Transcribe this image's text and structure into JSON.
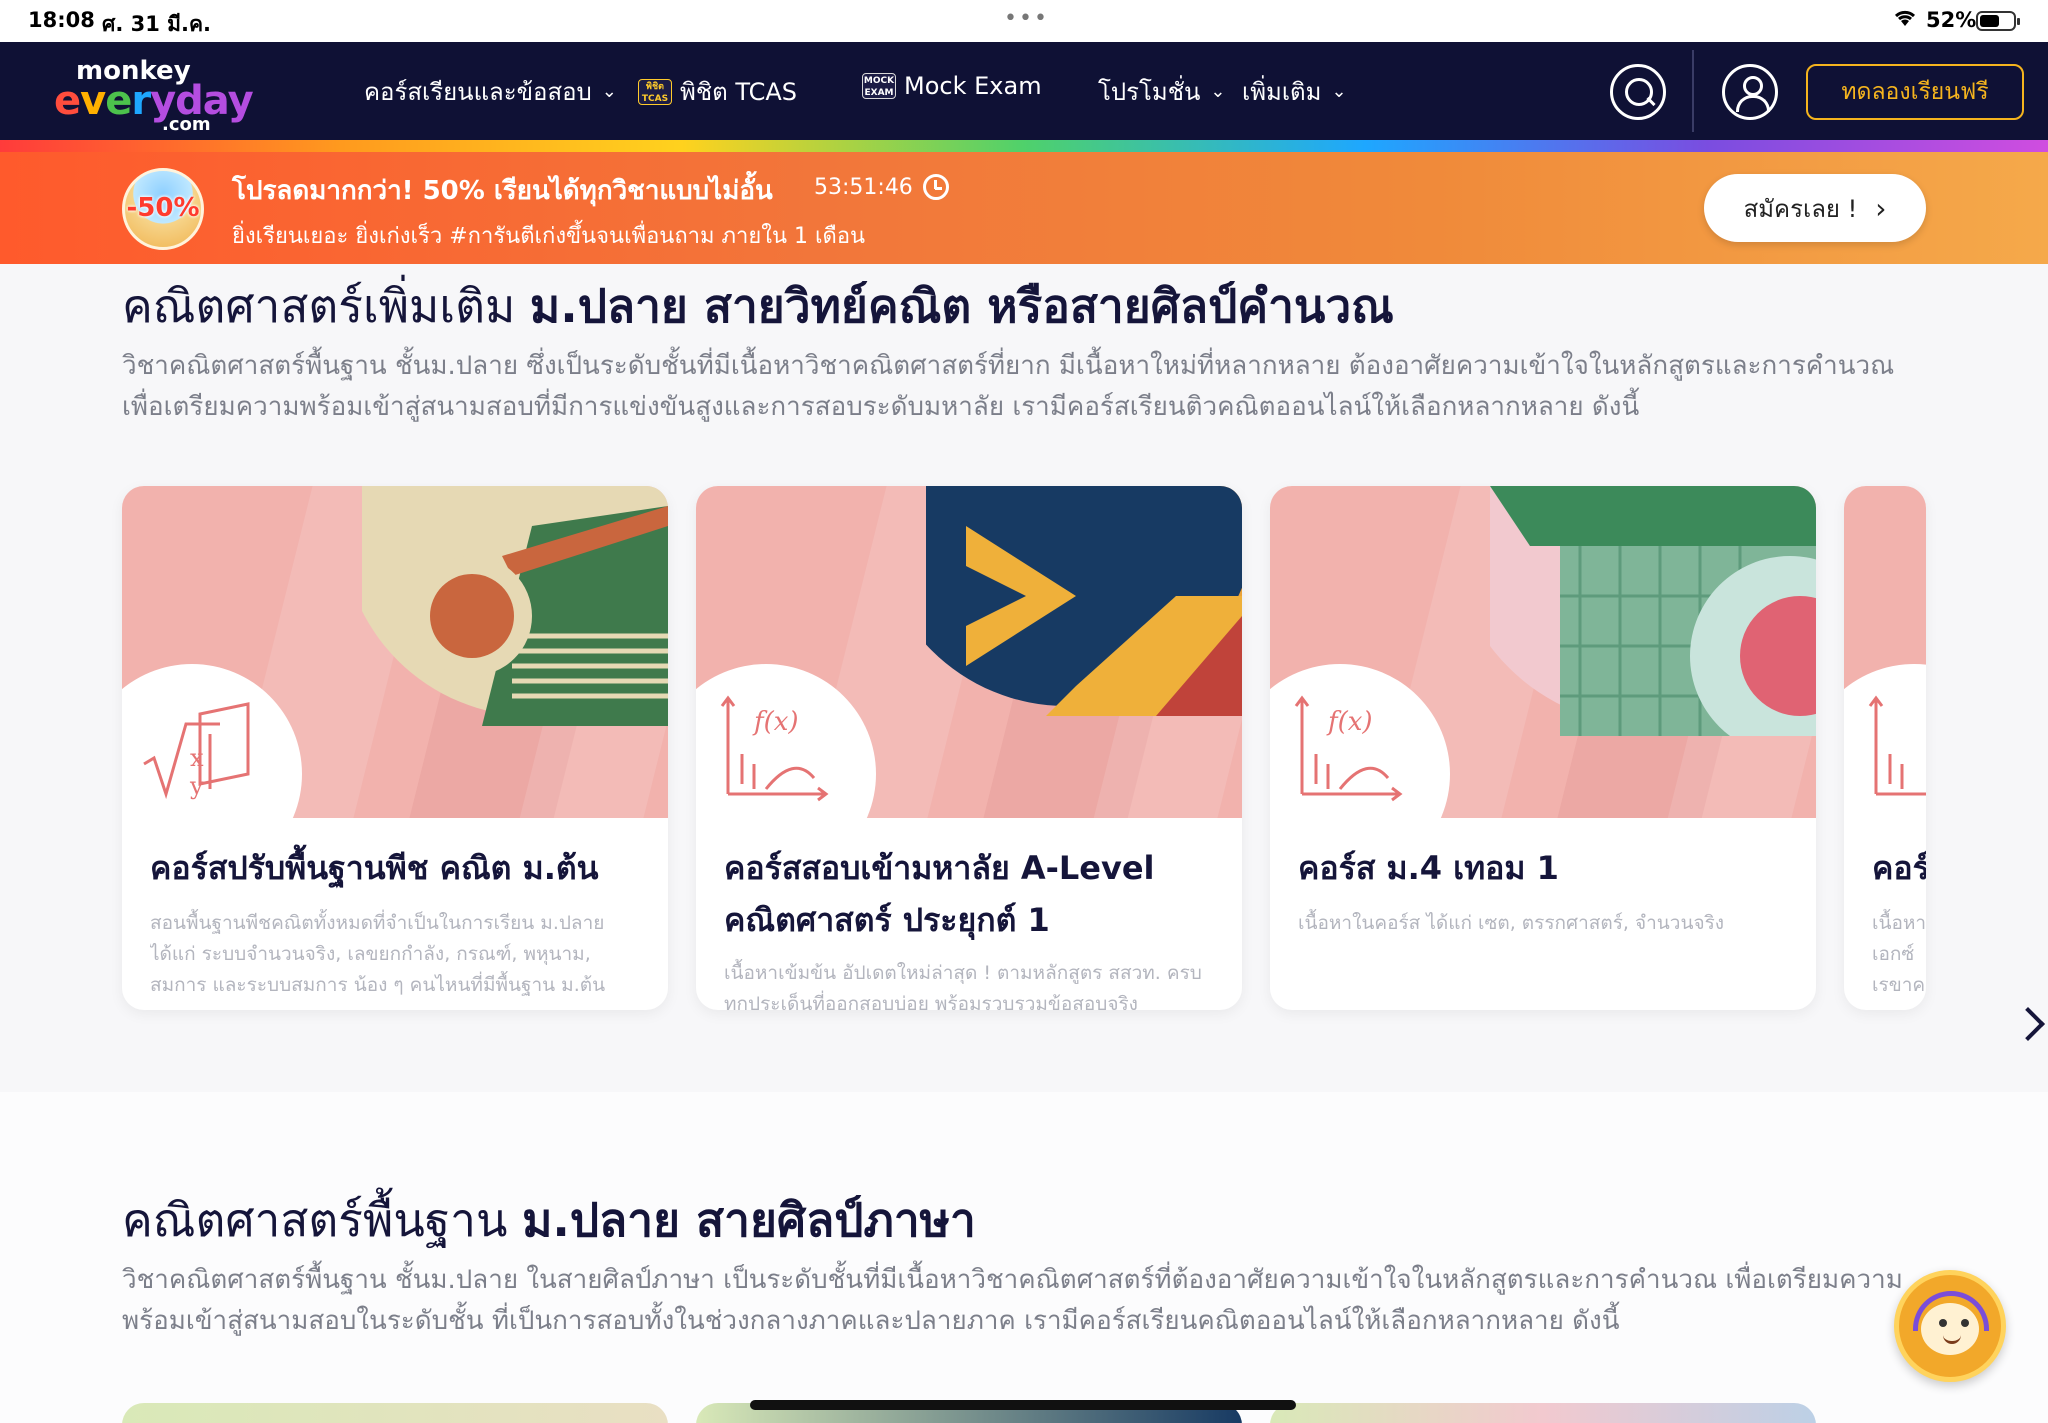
{
  "status_bar": {
    "time": "18:08",
    "date": "ศ. 31 มี.ค.",
    "battery": "52%",
    "battery_level": 0.52
  },
  "nav": {
    "logo": {
      "line1": "monkey",
      "line2": [
        "e",
        "v",
        "e",
        "r",
        "yday"
      ],
      "line3": ".com"
    },
    "items": [
      {
        "label": "คอร์สเรียนและข้อสอบ",
        "has_dropdown": true
      },
      {
        "label": "พิชิต TCAS",
        "badge": "พิชิต TCAS"
      },
      {
        "label": "Mock Exam",
        "badge": "MOCK EXAM"
      },
      {
        "label": "โปรโมชั่น",
        "has_dropdown": true
      },
      {
        "label": "เพิ่มเติม",
        "has_dropdown": true
      }
    ],
    "trial_button": "ทดลองเรียนฟรี",
    "icons": [
      "search-icon",
      "user-icon"
    ],
    "colors": {
      "background": "#0f1135",
      "accent": "#f5b41e"
    }
  },
  "promo": {
    "badge": "-50%",
    "title": "โปรลดมากกว่า! 50% เรียนได้ทุกวิชาแบบไม่อั้น",
    "timer": "53:51:46",
    "subtitle": "ยิ่งเรียนเยอะ ยิ่งเก่งเร็ว #การันตีเก่งขึ้นจนเพื่อนถาม ภายใน 1 เดือน",
    "cta": "สมัครเลย !",
    "colors": {
      "start": "#ff5a2c",
      "end": "#f5a94a"
    }
  },
  "section1": {
    "title_regular": "คณิตศาสตร์เพิ่มเติม ",
    "title_bold": "ม.ปลาย สายวิทย์คณิต หรือสายศิลป์คำนวณ",
    "description": "วิชาคณิตศาสตร์พื้นฐาน ชั้นม.ปลาย ซึ่งเป็นระดับชั้นที่มีเนื้อหาวิชาคณิตศาสตร์ที่ยาก มีเนื้อหาใหม่ที่หลากหลาย ต้องอาศัยความเข้าใจในหลักสูตรและการคำนวณ เพื่อเตรียมความพร้อมเข้าสู่สนามสอบที่มีการแข่งขันสูงและการสอบระดับมหาลัย เรามีคอร์สเรียนติวคณิตออนไลน์ให้เลือกหลากหลาย ดังนี้",
    "cards": [
      {
        "title": "คอร์สปรับพื้นฐานพีช คณิต ม.ต้น",
        "description": "สอนพื้นฐานพีชคณิตทั้งหมดที่จำเป็นในการเรียน ม.ปลาย ได้แก่ ระบบจำนวนจริง, เลขยกกำลัง, กรณฑ์, พหุนาม, สมการ และระบบสมการ น้อง ๆ คนไหนที่มีพื้นฐาน ม.ต้น",
        "icon": "sqrt-xy-icon"
      },
      {
        "title": "คอร์สสอบเข้ามหาลัย A-Level คณิตศาสตร์ ประยุกต์ 1",
        "description": "เนื้อหาเข้มข้น อัปเดตใหม่ล่าสุด ! ตามหลักสูตร สสวท. ครบทุกประเด็นที่ออกสอบบ่อย พร้อมรวบรวมข้อสอบจริง",
        "icon": "function-graph-icon"
      },
      {
        "title": "คอร์ส ม.4 เทอม 1",
        "description": "เนื้อหาในคอร์ส ได้แก่ เซต, ตรรกศาสตร์, จำนวนจริง",
        "icon": "function-graph-icon"
      },
      {
        "title": "คอร์",
        "description": "เนื้อหา เอกซ์ เรขาค",
        "icon": "function-graph-icon"
      }
    ]
  },
  "section2": {
    "title_regular": "คณิตศาสตร์พื้นฐาน ",
    "title_bold": "ม.ปลาย สายศิลป์ภาษา",
    "description": "วิชาคณิตศาสตร์พื้นฐาน ชั้นม.ปลาย ในสายศิลป์ภาษา เป็นระดับชั้นที่มีเนื้อหาวิชาคณิตศาสตร์ที่ต้องอาศัยความเข้าใจในหลักสูตรและการคำนวณ เพื่อเตรียมความพร้อมเข้าสู่สนามสอบในระดับชั้น ที่เป็นการสอบทั้งในช่วงกลางภาคและปลายภาค เรามีคอร์สเรียนคณิตออนไลน์ให้เลือกหลากหลาย ดังนี้"
  }
}
